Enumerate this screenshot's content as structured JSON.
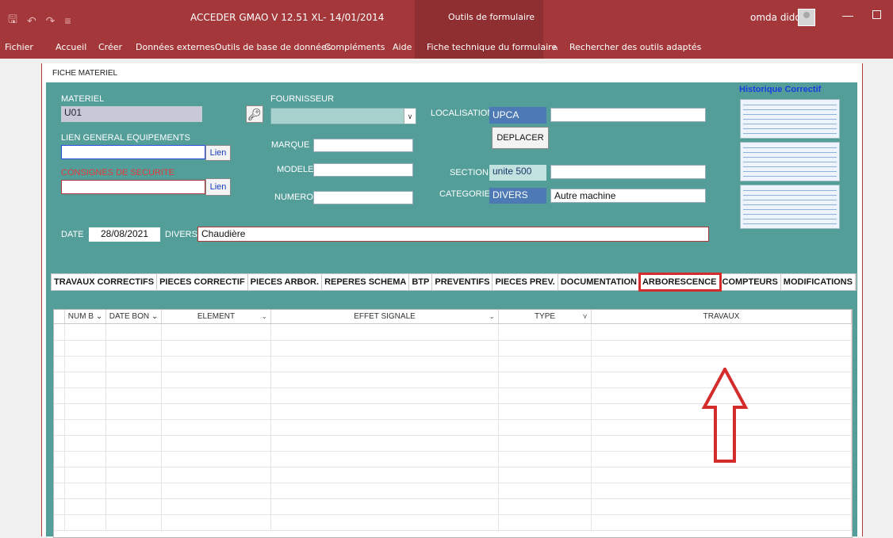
{
  "window": {
    "title": "ACCEDER GMAO V 12.51  XL- 14/01/2014",
    "context_tab": "Outils de formulaire",
    "user": "omda dido"
  },
  "menu": {
    "items": [
      "Fichier",
      "Accueil",
      "Créer",
      "Données externes",
      "Outils de base de données",
      "Compléments",
      "Aide",
      "Fiche technique du formulaire",
      "Rechercher des outils adaptés"
    ]
  },
  "form": {
    "title": "FICHE MATERIEL",
    "materiel_label": "MATERIEL",
    "materiel_value": "U01",
    "fournisseur_label": "FOURNISSEUR",
    "fournisseur_value": "",
    "lien_general_label": "LIEN GENERAL EQUIPEMENTS",
    "lien_general_value": "",
    "lien_button": "Lien",
    "consignes_label": "CONSIGNES DE SECURITE",
    "consignes_value": "",
    "marque_label": "MARQUE",
    "marque_value": "",
    "modele_label": "MODELE",
    "modele_value": "",
    "numero_label": "NUMERO",
    "numero_value": "",
    "localisation_label": "LOCALISATION",
    "localisation_code": "UPCA",
    "localisation_desc": "",
    "deplacer_button": "DEPLACER",
    "section_label": "SECTION",
    "section_code": "unite 500",
    "section_desc": "",
    "categorie_label": "CATEGORIE",
    "categorie_code": "DIVERS",
    "categorie_desc": "Autre machine",
    "date_label": "DATE",
    "date_value": "28/08/2021",
    "divers_label": "DIVERS",
    "divers_value": "Chaudière",
    "historique_label": "Historique  Correctif"
  },
  "tabs": [
    "TRAVAUX CORRECTIFS",
    "PIECES CORRECTIF",
    "PIECES ARBOR.",
    "REPERES SCHEMA",
    "BTP",
    "PREVENTIFS",
    "PIECES PREV.",
    "DOCUMENTATION",
    "ARBORESCENCE",
    "COMPTEURS",
    "MODIFICATIONS"
  ],
  "datasheet": {
    "columns": [
      "NUM B",
      "DATE BON",
      "ELEMENT",
      "EFFET SIGNALE",
      "TYPE",
      "TRAVAUX"
    ],
    "rows": []
  },
  "annotation": {
    "highlighted_tab": "ARBORESCENCE",
    "color": "#d42b2b"
  }
}
